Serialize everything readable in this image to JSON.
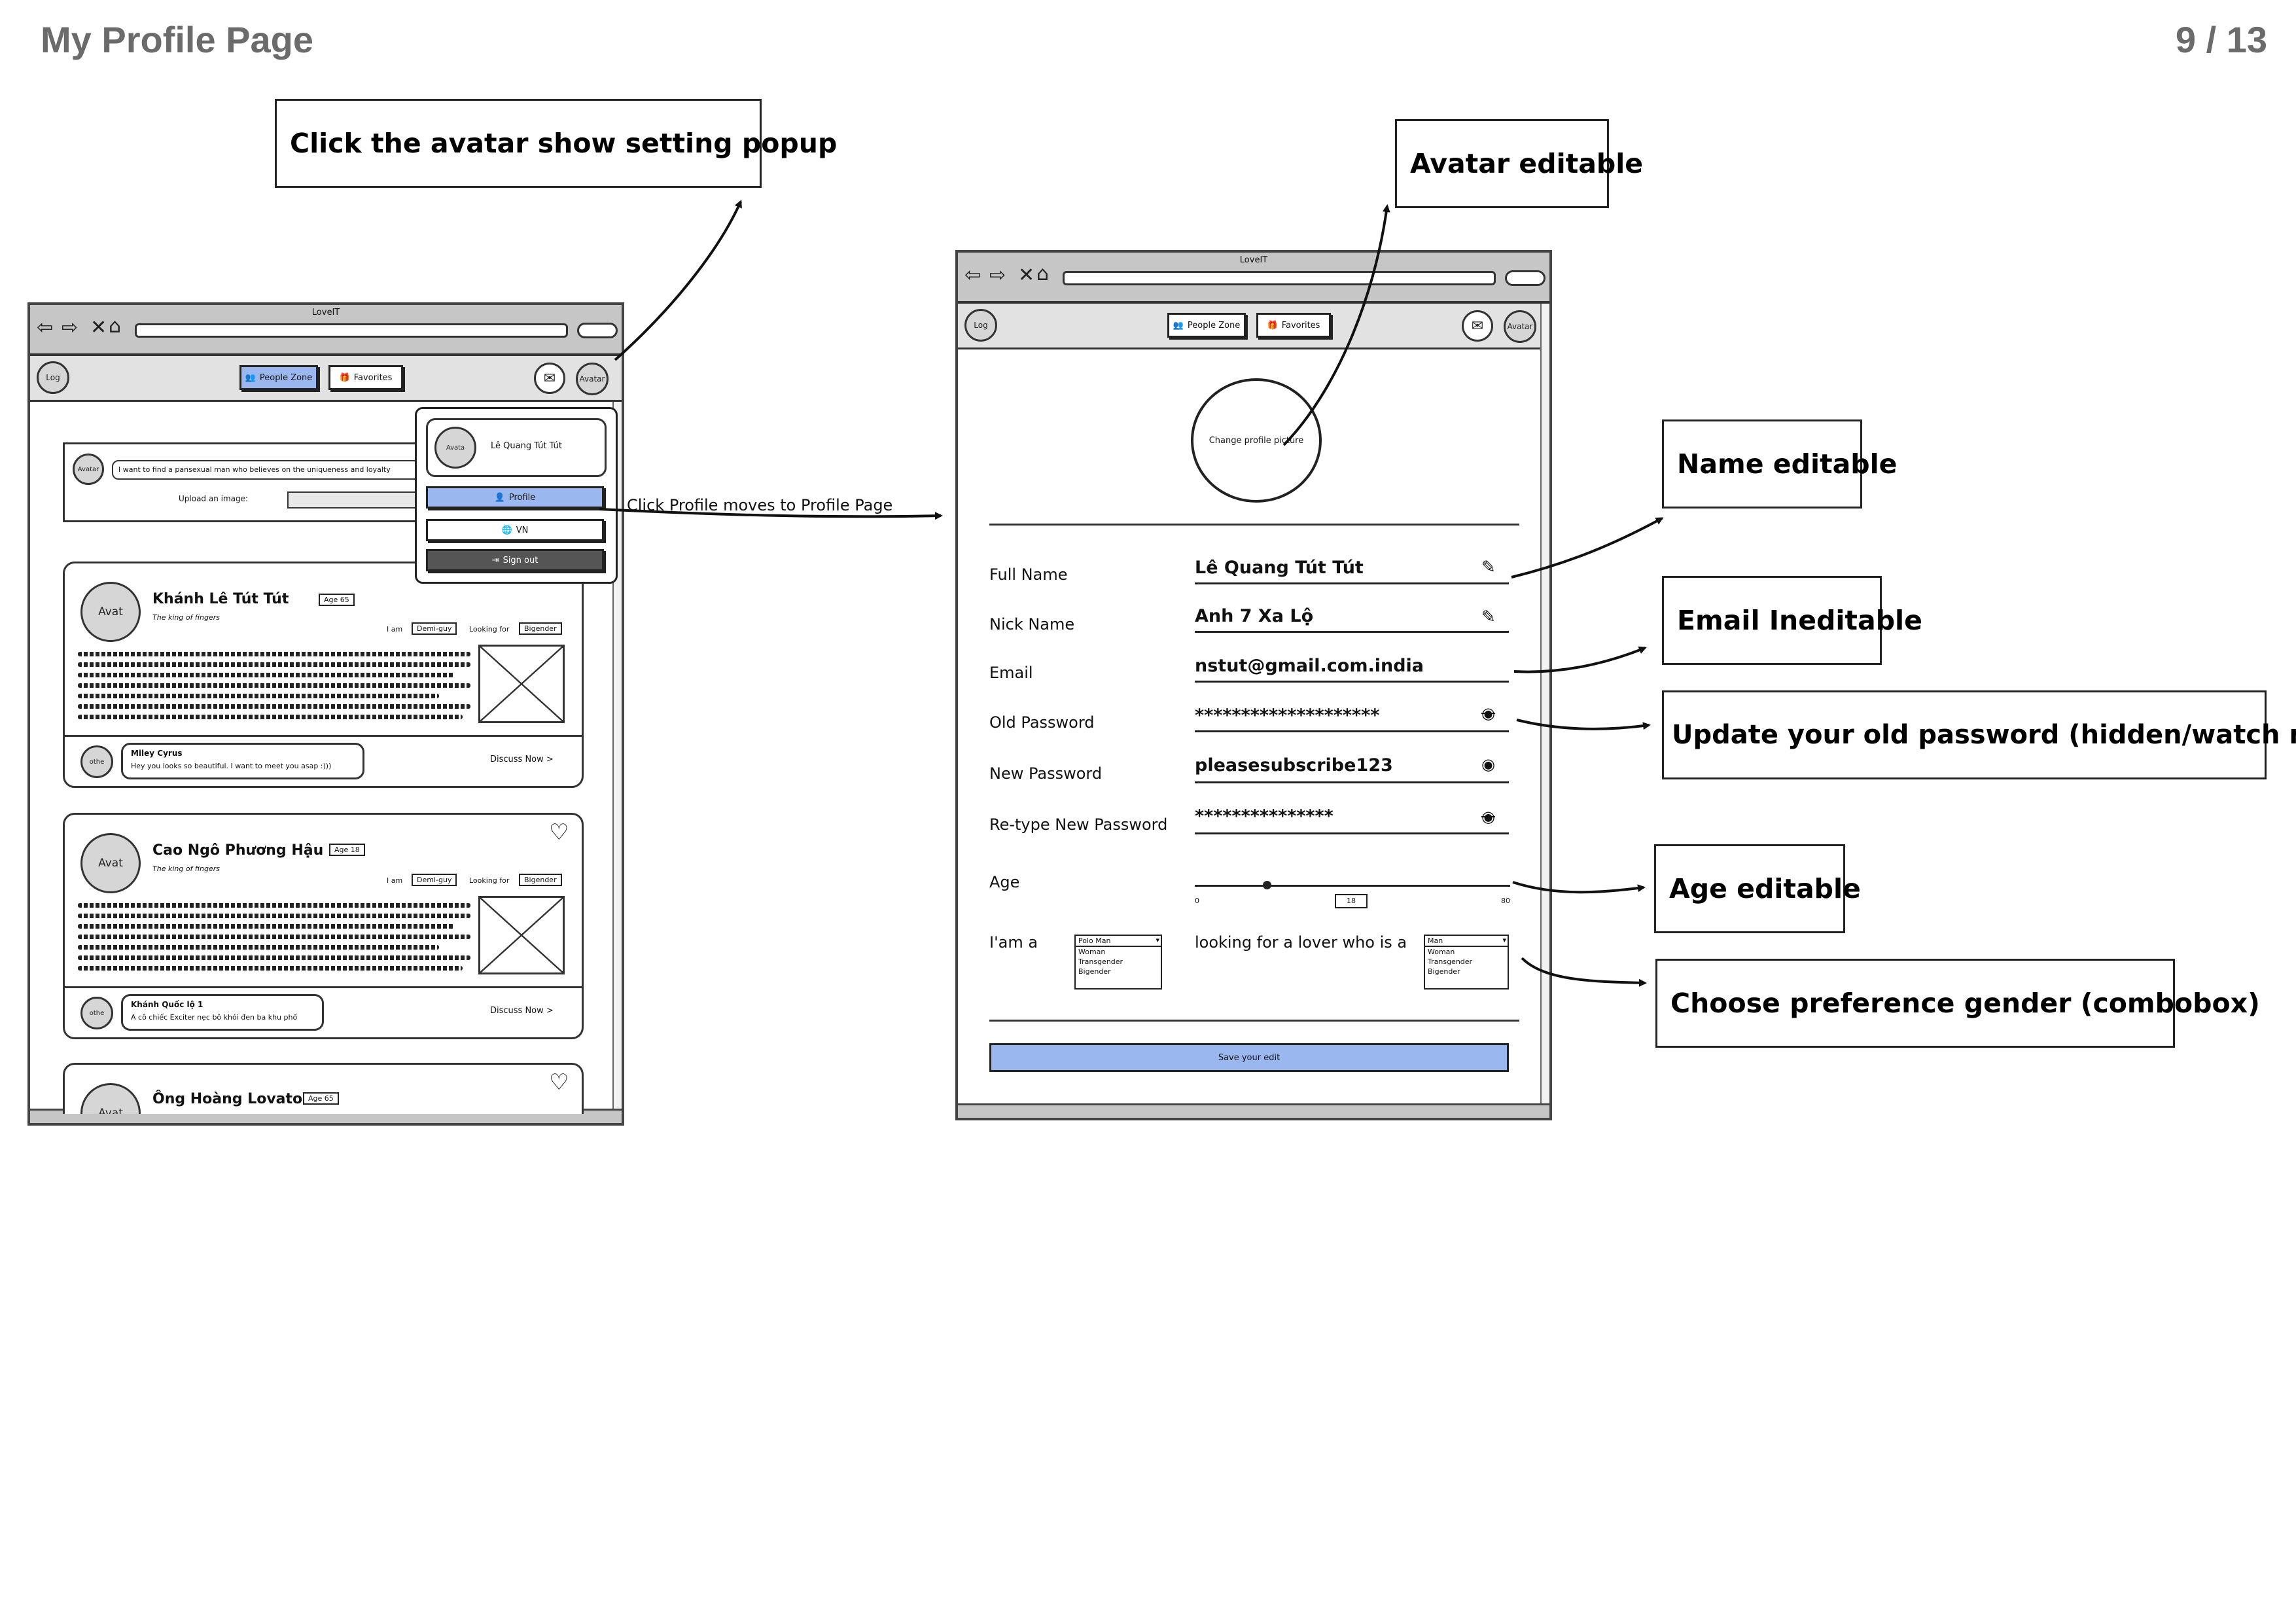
{
  "header": {
    "title": "My Profile Page",
    "page_indicator": "9 / 13"
  },
  "notes": {
    "avatar_popup": "Click the avatar show setting popup",
    "avatar_editable": "Avatar editable",
    "name_editable": "Name editable",
    "email_ineditable": "Email Ineditable",
    "update_password": "Update your old password (hidden/watch mode)",
    "age_editable": "Age editable",
    "choose_gender": "Choose preference gender (combobox)",
    "profile_link": "Click Profile moves to Profile Page"
  },
  "left_browser": {
    "window_title": "LoveIT",
    "logo": "Log",
    "nav": {
      "people_zone": "People Zone",
      "favorites": "Favorites",
      "avatar": "Avatar"
    },
    "post": {
      "avatar": "Avatar",
      "text": "I want to find a pansexual man who believes on the uniqueness and loyalty",
      "upload_label": "Upload an image:"
    },
    "popup": {
      "avatar": "Avata",
      "name": "Lê Quang Tút Tút",
      "profile": "Profile",
      "language": "VN",
      "signout": "Sign out"
    },
    "cards": [
      {
        "avatar": "Avat",
        "name": "Khánh Lê Tút Tút",
        "age": "Age 65",
        "subtitle": "The king of fingers",
        "i_am_label": "I am",
        "i_am": "Demi-guy",
        "looking_label": "Looking for",
        "looking": "Bigender",
        "comment_avatar": "othe",
        "comment_author": "Miley Cyrus",
        "comment_text": "Hey you looks so beautiful. I want to meet you asap :)))",
        "discuss": "Discuss Now >"
      },
      {
        "avatar": "Avat",
        "name": "Cao Ngô Phương Hậu",
        "age": "Age 18",
        "subtitle": "The king of fingers",
        "i_am_label": "I am",
        "i_am": "Demi-guy",
        "looking_label": "Looking for",
        "looking": "Bigender",
        "comment_avatar": "othe",
        "comment_author": "Khánh Quốc lộ 1",
        "comment_text": "A cô chiếc Exciter nẹc bô khói đen ba khu phố",
        "discuss": "Discuss Now >"
      },
      {
        "avatar": "Avat",
        "name": "Ông Hoàng Lovato",
        "age": "Age 65"
      }
    ]
  },
  "right_browser": {
    "window_title": "LoveIT",
    "logo": "Log",
    "nav": {
      "people_zone": "People Zone",
      "favorites": "Favorites",
      "avatar": "Avatar"
    },
    "change_picture": "Change profile picture",
    "fields": [
      {
        "label": "Full Name",
        "value": "Lê Quang Tút Tút",
        "icon": "pencil-icon"
      },
      {
        "label": "Nick Name",
        "value": "Anh 7 Xa Lộ",
        "icon": "pencil-icon"
      },
      {
        "label": "Email",
        "value": "nstut@gmail.com.india",
        "icon": ""
      },
      {
        "label": "Old Password",
        "value": "********************",
        "icon": "eye-off-icon"
      },
      {
        "label": "New Password",
        "value": "pleasesubscribe123",
        "icon": "eye-icon"
      },
      {
        "label": "Re-type New Password",
        "value": "***************",
        "icon": "eye-off-icon"
      }
    ],
    "age": {
      "label": "Age",
      "min": "0",
      "max": "80",
      "value": "18"
    },
    "gender": {
      "i_am_label": "I'am a",
      "i_am_selected": "Polo Man",
      "i_am_options": [
        "Woman",
        "Transgender",
        "Bigender"
      ],
      "looking_label": "looking for a lover who is a",
      "looking_selected": "Man",
      "looking_options": [
        "Woman",
        "Transgender",
        "Bigender"
      ]
    },
    "save": "Save your edit"
  }
}
